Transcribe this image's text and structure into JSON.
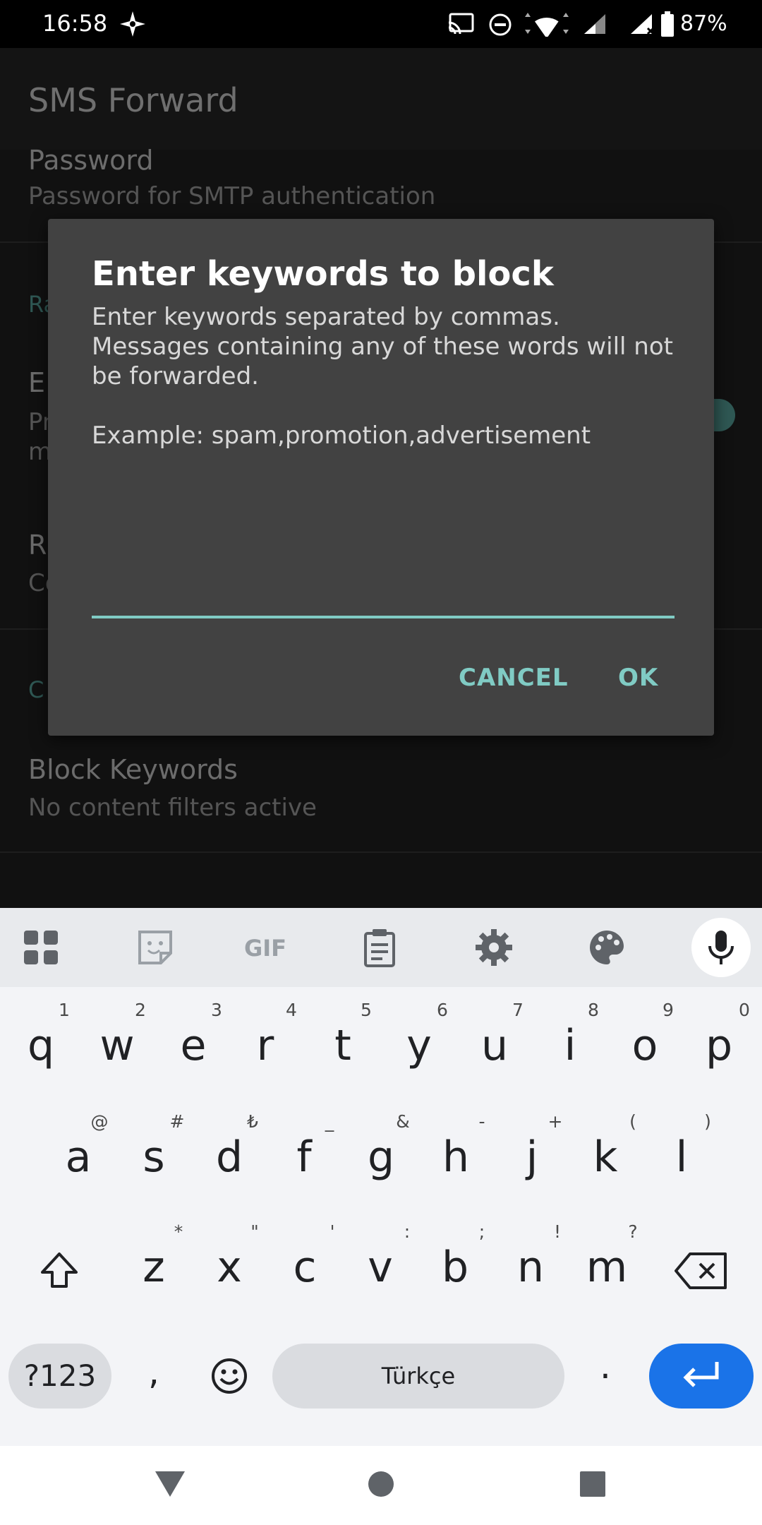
{
  "status_bar": {
    "time": "16:58",
    "battery": "87%"
  },
  "app": {
    "title": "SMS Forward",
    "password_title": "Password",
    "password_summary": "Password for SMTP authentication",
    "category1_partial": "Ra",
    "item1_title_partial": "E",
    "item1_summary_partial_1": "Pr",
    "item1_summary_partial_2": "m",
    "item2_title_partial": "R",
    "item2_summary_partial": "Co",
    "category2_partial": "C",
    "block_title": "Block Keywords",
    "block_summary": "No content filters active"
  },
  "dialog": {
    "title": "Enter keywords to block",
    "message": "Enter keywords separated by commas. Messages containing any of these words will not be forwarded.\n\nExample: spam,promotion,advertisement",
    "input_value": "",
    "cancel_label": "CANCEL",
    "ok_label": "OK"
  },
  "keyboard": {
    "toolbar_icons": [
      "apps-grid-icon",
      "sticker-icon",
      "gif-icon",
      "clipboard-icon",
      "settings-icon",
      "palette-icon",
      "mic-icon"
    ],
    "gif_label": "GIF",
    "row1": [
      "q",
      "w",
      "e",
      "r",
      "t",
      "y",
      "u",
      "i",
      "o",
      "p"
    ],
    "row1_hints": [
      "1",
      "2",
      "3",
      "4",
      "5",
      "6",
      "7",
      "8",
      "9",
      "0"
    ],
    "row2": [
      "a",
      "s",
      "d",
      "f",
      "g",
      "h",
      "j",
      "k",
      "l"
    ],
    "row2_hints": [
      "@",
      "#",
      "₺",
      "_",
      "&",
      "-",
      "+",
      "(",
      ")"
    ],
    "row3": [
      "z",
      "x",
      "c",
      "v",
      "b",
      "n",
      "m"
    ],
    "row3_hints": [
      "*",
      "\"",
      "'",
      ":",
      ";",
      "!",
      "?"
    ],
    "symbols_label": "?123",
    "comma_label": ",",
    "space_label": "Türkçe",
    "period_label": "."
  },
  "colors": {
    "accent": "#80cbc4",
    "enter_key": "#1a73e8"
  }
}
